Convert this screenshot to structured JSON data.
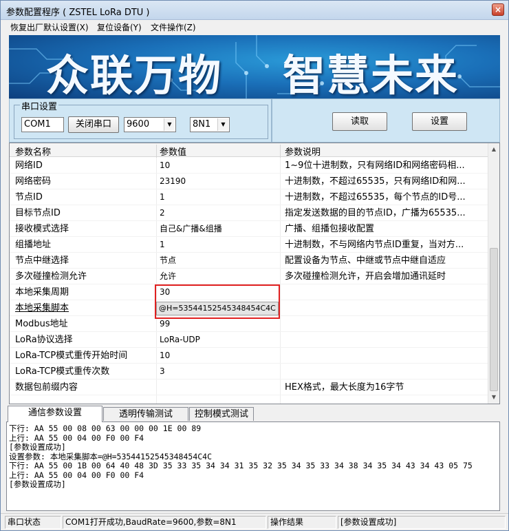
{
  "window": {
    "title": "参数配置程序  ( ZSTEL LoRa DTU )",
    "close_label": "×"
  },
  "menu": [
    "恢复出厂默认设置(X)",
    "复位设备(Y)",
    "文件操作(Z)"
  ],
  "banner": {
    "left_text": "众联万物",
    "right_text": "智慧未来",
    "bg_color": "#1a6fb8"
  },
  "serial": {
    "group_label": "串口设置",
    "port_value": "COM1",
    "close_port_button": "关闭串口",
    "baud_rate": "9600",
    "data_format": "8N1"
  },
  "actions": {
    "read_button": "读取",
    "set_button": "设置"
  },
  "grid": {
    "headers": [
      "参数名称",
      "参数值",
      "参数说明"
    ],
    "rows": [
      {
        "name": "网络ID",
        "value": "10",
        "desc": "1~9位十进制数，只有网络ID和网络密码相..."
      },
      {
        "name": "网络密码",
        "value": "23190",
        "desc": "十进制数，不超过65535，只有网络ID和网..."
      },
      {
        "name": "节点ID",
        "value": "1",
        "desc": "十进制数，不超过65535，每个节点的ID号..."
      },
      {
        "name": "目标节点ID",
        "value": "2",
        "desc": "指定发送数据的目的节点ID，广播为65535..."
      },
      {
        "name": "接收模式选择",
        "value": "自己&广播&组播",
        "desc": "广播、组播包接收配置"
      },
      {
        "name": "组播地址",
        "value": "1",
        "desc": "十进制数，不与网络内节点ID重复，当对方..."
      },
      {
        "name": "节点中继选择",
        "value": "节点",
        "desc": "配置设备为节点、中继或节点中继自适应"
      },
      {
        "name": "多次碰撞检测允许",
        "value": "允许",
        "desc": "多次碰撞检测允许，开启会增加通讯延时"
      },
      {
        "name": "本地采集周期",
        "value": "30",
        "desc": ""
      },
      {
        "name": "本地采集脚本",
        "value": "@H=53544152545348454C4C",
        "desc": ""
      },
      {
        "name": "Modbus地址",
        "value": "99",
        "desc": ""
      },
      {
        "name": "LoRa协议选择",
        "value": "LoRa-UDP",
        "desc": ""
      },
      {
        "name": "LoRa-TCP模式重传开始时间",
        "value": "10",
        "desc": ""
      },
      {
        "name": "LoRa-TCP模式重传次数",
        "value": "3",
        "desc": ""
      },
      {
        "name": "数据包前缀内容",
        "value": "",
        "desc": "HEX格式，最大长度为16字节"
      }
    ],
    "highlight_color": "#e02020"
  },
  "tabs": [
    "通信参数设置",
    "透明传输测试",
    "控制模式测试"
  ],
  "log_lines": [
    "下行: AA 55 00 08 00 63 00 00 00 1E 00 89",
    "上行: AA 55 00 04 00 F0 00 F4",
    "[参数设置成功]",
    "设置参数: 本地采集脚本=@H=53544152545348454C4C",
    "下行: AA 55 00 1B 00 64 40 48 3D 35 33 35 34 34 31 35 32 35 34 35 33 34 38 34 35 34 43 34 43 05 75",
    "上行: AA 55 00 04 00 F0 00 F4",
    "[参数设置成功]"
  ],
  "status": [
    "串口状态",
    "COM1打开成功,BaudRate=9600,参数=8N1",
    "操作结果",
    "[参数设置成功]"
  ]
}
